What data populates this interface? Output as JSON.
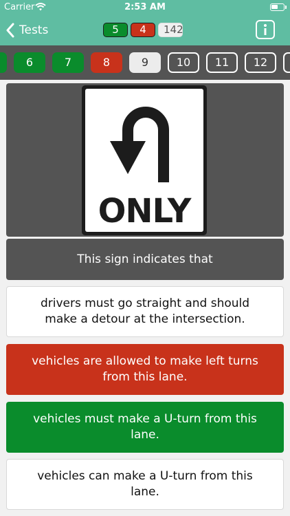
{
  "status_bar": {
    "carrier": "Carrier",
    "time": "2:53 AM"
  },
  "nav": {
    "back_label": "Tests",
    "score_correct": "5",
    "score_wrong": "4",
    "score_total": "142"
  },
  "questions_strip": [
    {
      "label": "",
      "state": "correct"
    },
    {
      "label": "6",
      "state": "correct"
    },
    {
      "label": "7",
      "state": "correct"
    },
    {
      "label": "8",
      "state": "wrong"
    },
    {
      "label": "9",
      "state": "current"
    },
    {
      "label": "10",
      "state": "pending"
    },
    {
      "label": "11",
      "state": "pending"
    },
    {
      "label": "12",
      "state": "pending"
    },
    {
      "label": "",
      "state": "pending"
    }
  ],
  "sign": {
    "text": "ONLY"
  },
  "question": {
    "text": "This sign indicates that"
  },
  "answers": [
    {
      "text": "drivers must go straight and should make a detour at the intersection.",
      "state": "neutral"
    },
    {
      "text": "vehicles are allowed to make left turns from this lane.",
      "state": "wrong"
    },
    {
      "text": "vehicles must make a U-turn from this lane.",
      "state": "correct"
    },
    {
      "text": "vehicles can make a U-turn from this lane.",
      "state": "neutral"
    }
  ],
  "colors": {
    "header": "#5fbda2",
    "correct": "#0a8c2c",
    "wrong": "#c8321b",
    "dark_panel": "#545454"
  }
}
